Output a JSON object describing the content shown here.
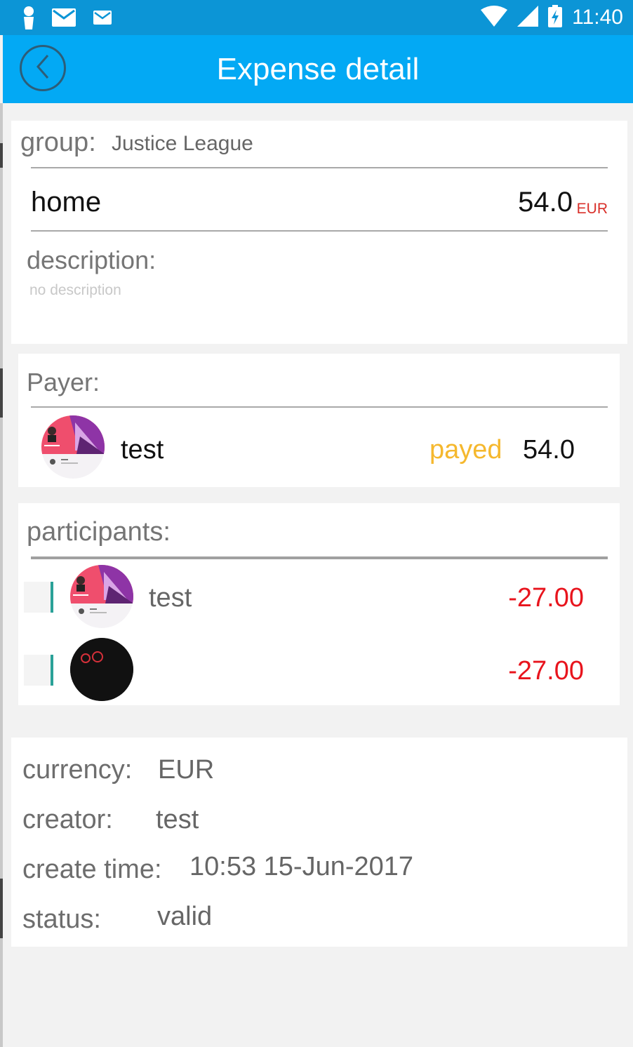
{
  "status_bar": {
    "time": "11:40"
  },
  "toolbar": {
    "title": "Expense detail"
  },
  "expense": {
    "group_label": "group:",
    "group_name": "Justice League",
    "category": "home",
    "amount": "54.0",
    "currency_small": "EUR",
    "description_label": "description:",
    "description_value": "no description"
  },
  "payer": {
    "section_label": "Payer:",
    "name": "test",
    "status": "payed",
    "amount": "54.0"
  },
  "participants": {
    "section_label": "participants:",
    "items": [
      {
        "name": "test",
        "amount": "-27.00"
      },
      {
        "name": "",
        "amount": "-27.00"
      }
    ]
  },
  "meta": {
    "currency_label": "currency:",
    "currency_value": "EUR",
    "creator_label": "creator:",
    "creator_value": "test",
    "create_time_label": "create time:",
    "create_time_value": "10:53 15-Jun-2017",
    "status_label": "status:",
    "status_value": "valid"
  },
  "colors": {
    "toolbar": "#03a9f4",
    "status_bar": "#0c95d6",
    "payed": "#f5b82e",
    "negative_amount": "#e8141d",
    "currency_accent": "#d9302a",
    "participant_marker": "#2aa198"
  }
}
